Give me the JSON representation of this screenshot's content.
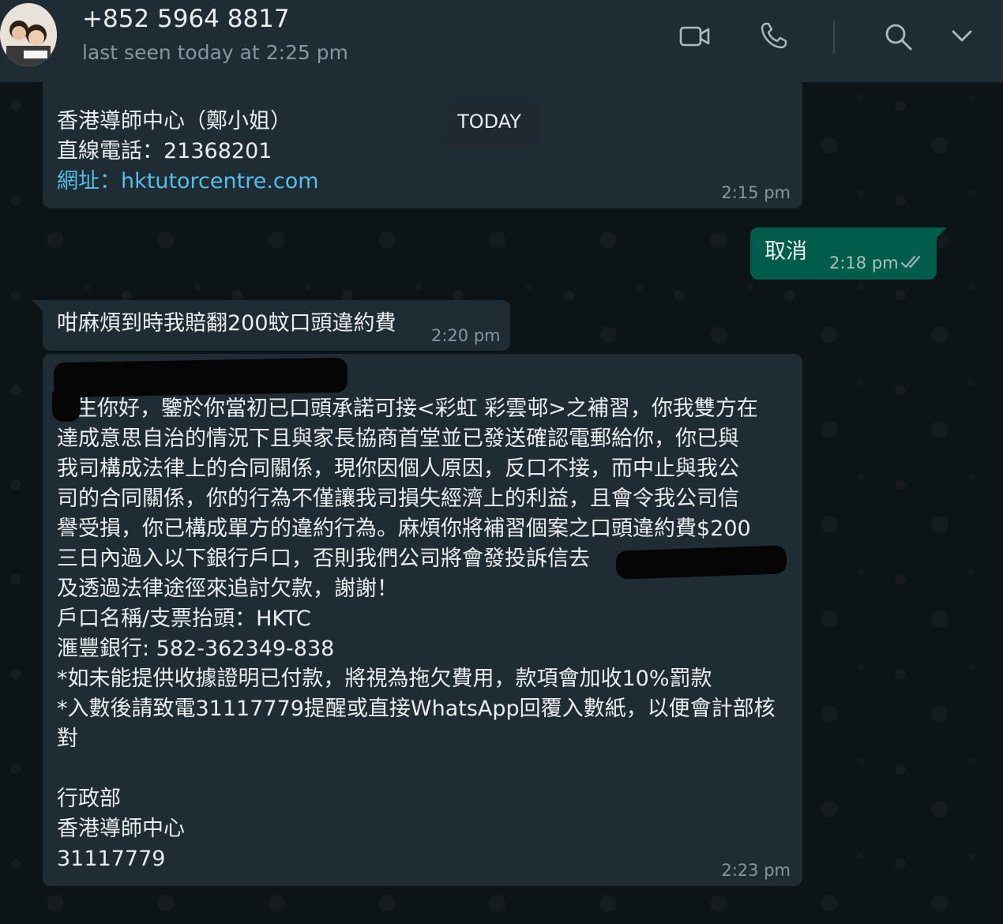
{
  "header": {
    "contact_name": "+852 5964 8817",
    "last_seen": "last seen today at 2:25 pm",
    "icons": [
      "video-call-icon",
      "voice-call-icon",
      "search-icon",
      "chevron-down-icon"
    ]
  },
  "date_separator": "TODAY",
  "messages": [
    {
      "direction": "incoming",
      "lines": [
        "香港導師中心（鄭小姐）",
        "直線電話：21368201"
      ],
      "link_text": "網址：hktutorcentre.com",
      "time": "2:15 pm"
    },
    {
      "direction": "outgoing",
      "text": "取消",
      "time": "2:18 pm",
      "status": "read"
    },
    {
      "direction": "incoming",
      "text": "咁麻煩到時我賠翻200蚊口頭違約費",
      "time": "2:20 pm"
    },
    {
      "direction": "incoming",
      "lines": [
        "生你好，鑒於你當初已口頭承諾可接<彩虹 彩雲邨>之補習，你我雙方在",
        "達成意思自治的情況下且與家長協商首堂並已發送確認電郵給你，你已與",
        "我司構成法律上的合同關係，現你因個人原因，反口不接，而中止與我公",
        "司的合同關係，你的行為不僅讓我司損失經濟上的利益，且會令我公司信",
        "譽受損，你已構成單方的違約行為。麻煩你將補習個案之口頭違約費$200",
        "三日內過入以下銀行戶口，否則我們公司將會發投訴信去",
        "及透過法律途徑來追討欠款，謝謝！",
        "戶口名稱/支票抬頭：HKTC",
        "滙豐銀行: 582-362349-838",
        "*如未能提供收據證明已付款，將視為拖欠費用，款項會加收10%罰款",
        "*入數後請致電31117779提醒或直接WhatsApp回覆入數紙，以便會計部核",
        "對",
        "",
        "行政部",
        "香港導師中心",
        "31117779"
      ],
      "time": "2:23 pm"
    }
  ],
  "colors": {
    "header_bg": "#1f2c33",
    "incoming_bubble": "#202c33",
    "outgoing_bubble": "#005c4b",
    "link": "#53bdeb",
    "read_ticks": "#8696a0"
  }
}
